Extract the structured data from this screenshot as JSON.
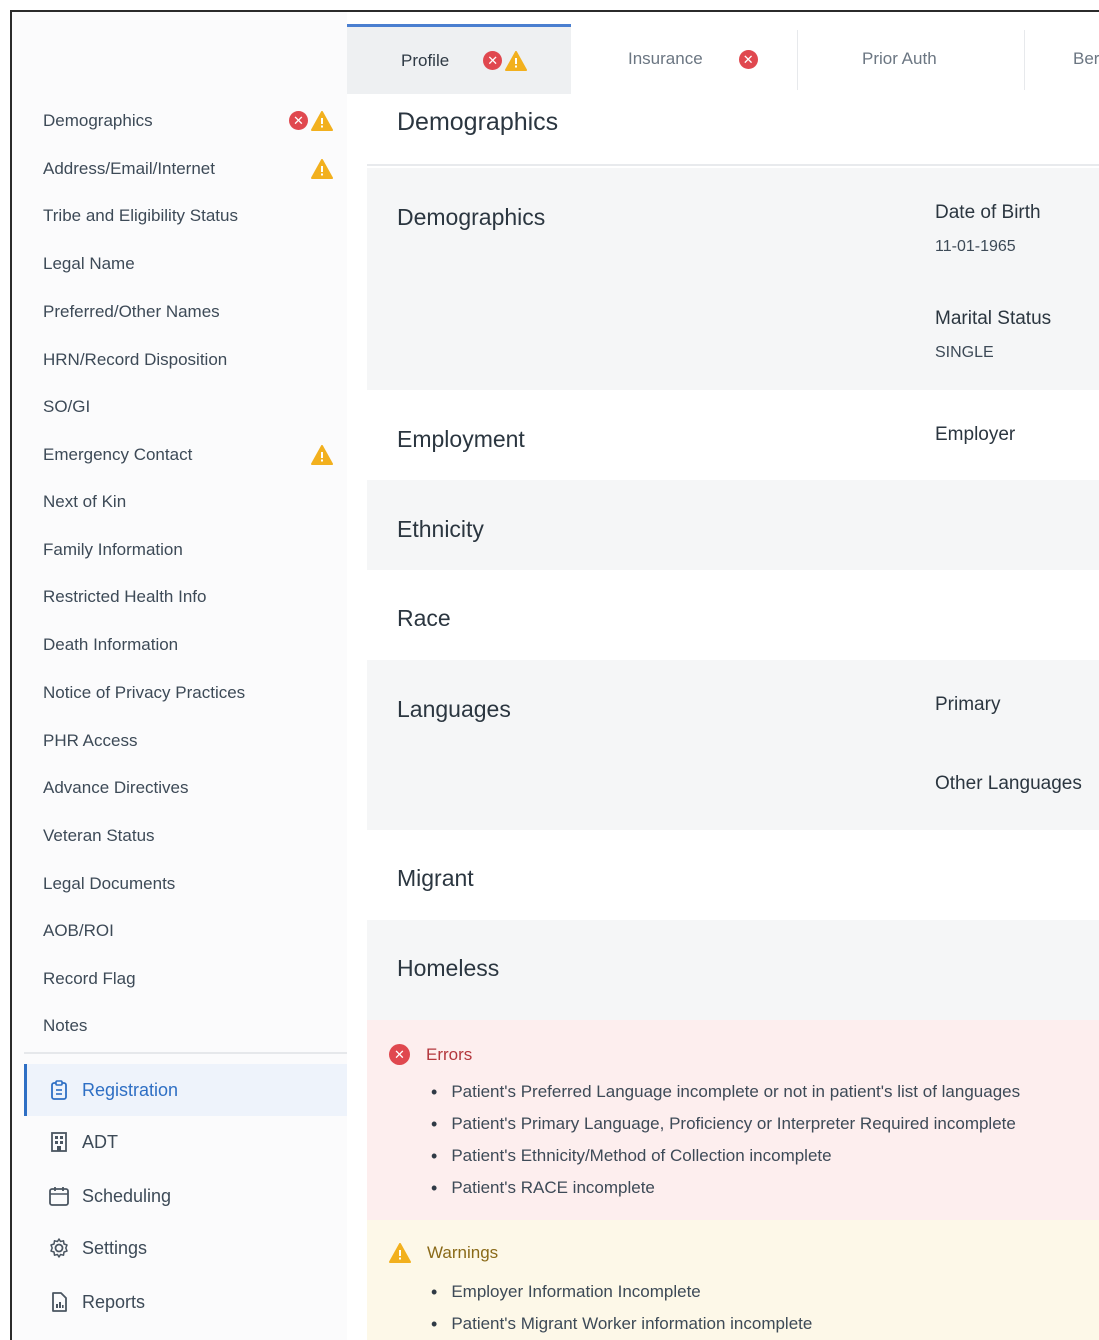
{
  "tabs": [
    {
      "label": "Profile",
      "errors": true,
      "warnings": true
    },
    {
      "label": "Insurance",
      "errors": true,
      "warnings": false
    },
    {
      "label": "Prior Auth",
      "errors": false,
      "warnings": false
    },
    {
      "label": "Ber",
      "errors": false,
      "warnings": false
    }
  ],
  "sidebar": {
    "items": [
      {
        "label": "Demographics",
        "error": true,
        "warning": true
      },
      {
        "label": "Address/Email/Internet",
        "error": false,
        "warning": true
      },
      {
        "label": "Tribe and Eligibility Status"
      },
      {
        "label": "Legal Name"
      },
      {
        "label": "Preferred/Other Names"
      },
      {
        "label": "HRN/Record Disposition"
      },
      {
        "label": "SO/GI"
      },
      {
        "label": "Emergency Contact",
        "error": false,
        "warning": true
      },
      {
        "label": "Next of Kin"
      },
      {
        "label": "Family Information"
      },
      {
        "label": "Restricted Health Info"
      },
      {
        "label": "Death Information"
      },
      {
        "label": "Notice of Privacy Practices"
      },
      {
        "label": "PHR Access"
      },
      {
        "label": "Advance Directives"
      },
      {
        "label": "Veteran Status"
      },
      {
        "label": "Legal Documents"
      },
      {
        "label": "AOB/ROI"
      },
      {
        "label": "Record Flag"
      },
      {
        "label": "Notes"
      }
    ],
    "app_nav": [
      {
        "label": "Registration",
        "icon": "clipboard-icon",
        "active": true
      },
      {
        "label": "ADT",
        "icon": "building-icon"
      },
      {
        "label": "Scheduling",
        "icon": "calendar-icon"
      },
      {
        "label": "Settings",
        "icon": "gear-icon"
      },
      {
        "label": "Reports",
        "icon": "report-icon"
      }
    ]
  },
  "main": {
    "title": "Demographics",
    "sections": {
      "demographics": {
        "title": "Demographics",
        "dob_label": "Date of Birth",
        "dob_value": "11-01-1965",
        "marital_label": "Marital Status",
        "marital_value": "SINGLE"
      },
      "employment": {
        "title": "Employment",
        "employer_label": "Employer"
      },
      "ethnicity": {
        "title": "Ethnicity"
      },
      "race": {
        "title": "Race"
      },
      "languages": {
        "title": "Languages",
        "primary_label": "Primary",
        "other_label": "Other Languages"
      },
      "migrant": {
        "title": "Migrant"
      },
      "homeless": {
        "title": "Homeless"
      }
    },
    "errors": {
      "heading": "Errors",
      "items": [
        "Patient's Preferred Language incomplete or not in patient's list of languages",
        "Patient's Primary Language, Proficiency or Interpreter Required incomplete",
        "Patient's Ethnicity/Method of Collection incomplete",
        "Patient's RACE incomplete"
      ]
    },
    "warnings": {
      "heading": "Warnings",
      "items": [
        "Employer Information Incomplete",
        "Patient's Migrant Worker information incomplete"
      ]
    }
  },
  "colors": {
    "error": "#e0484f",
    "warning": "#f2b01e",
    "accent": "#2e6fc4"
  }
}
